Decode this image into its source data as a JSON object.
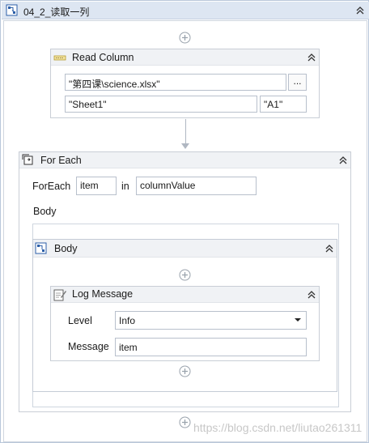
{
  "sequence": {
    "title": "04_2_读取一列",
    "icon": "sequence-icon",
    "collapse_icon": "chevron-double-up-icon"
  },
  "read_column": {
    "title": "Read Column",
    "icon": "read-column-icon",
    "file_path": "\"第四课\\science.xlsx\"",
    "browse_label": "...",
    "sheet_name": "\"Sheet1\"",
    "start_cell": "\"A1\""
  },
  "for_each": {
    "title": "For Each",
    "icon": "for-each-icon",
    "foreach_label": "ForEach",
    "item_value": "item",
    "in_label": "in",
    "collection_value": "columnValue",
    "body_label": "Body"
  },
  "body_sequence": {
    "title": "Body",
    "icon": "sequence-icon"
  },
  "log_message": {
    "title": "Log Message",
    "icon": "log-message-icon",
    "level_label": "Level",
    "level_value": "Info",
    "message_label": "Message",
    "message_value": "item"
  },
  "add_icon": "plus-circle-icon",
  "watermark": "https://blog.csdn.net/liutao261311"
}
